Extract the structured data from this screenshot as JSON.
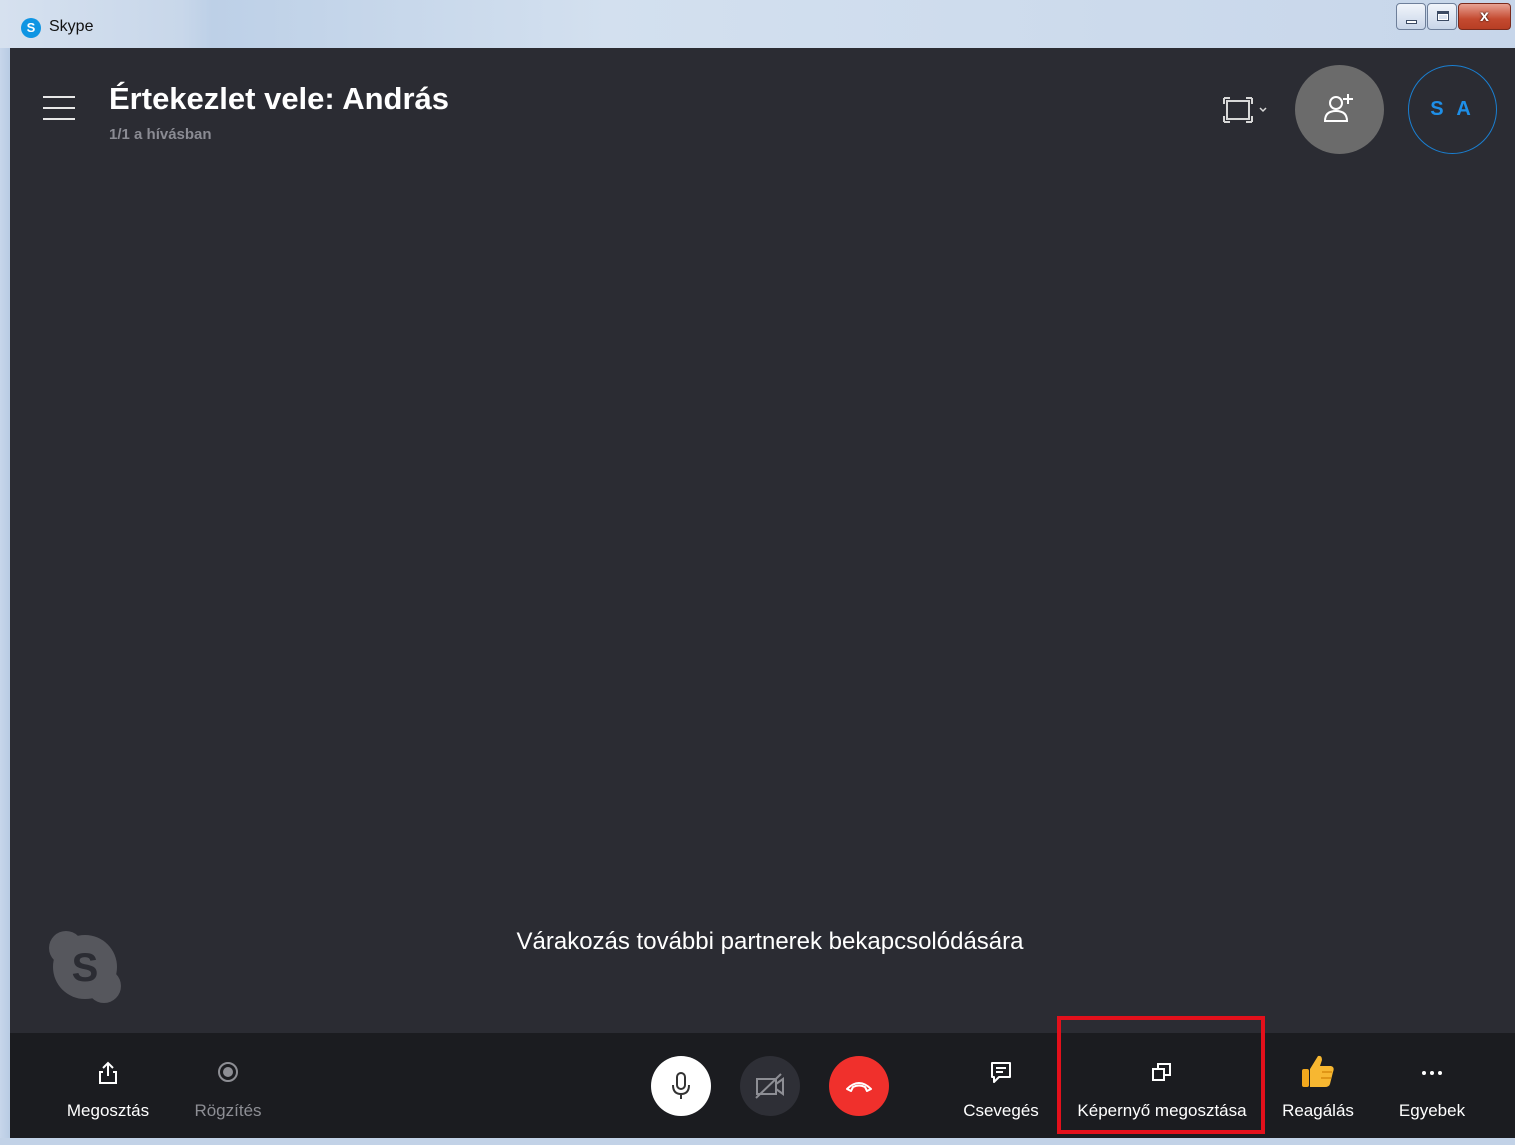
{
  "window": {
    "title": "Skype",
    "controls": {
      "minimize": "minimize",
      "maximize": "maximize",
      "close": "x"
    }
  },
  "header": {
    "title": "Értekezlet vele: András",
    "subtitle": "1/1 a hívásban",
    "avatar_initials": "S A"
  },
  "stage": {
    "waiting_message": "Várakozás további partnerek bekapcsolódására"
  },
  "controls": {
    "share": "Megosztás",
    "record": "Rögzítés",
    "chat": "Csevegés",
    "screen_share": "Képernyő megosztása",
    "react": "Reagálás",
    "more": "Egyebek"
  },
  "icons": {
    "app": "skype-logo-icon",
    "menu": "hamburger-icon",
    "layout": "layout-frame-icon",
    "add_people": "add-person-icon",
    "share": "share-upload-icon",
    "record": "record-dot-icon",
    "mic": "microphone-icon",
    "video": "video-off-icon",
    "hangup": "hang-up-icon",
    "chat": "chat-icon",
    "screen_share": "screen-share-icon",
    "react": "thumbs-up-icon",
    "more": "ellipsis-icon"
  },
  "colors": {
    "stage_background": "#2b2c33",
    "control_bar": "#1b1c20",
    "hangup": "#f0302c",
    "avatar_accent": "#1e8fe8",
    "highlight": "#e3101b",
    "react_thumb": "#f7b731"
  }
}
